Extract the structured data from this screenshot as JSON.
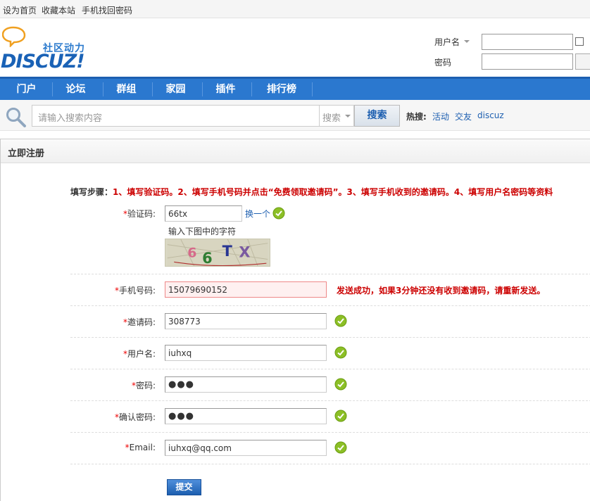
{
  "topbar": {
    "links": [
      "设为首页",
      "收藏本站",
      "手机找回密码"
    ]
  },
  "logo": {
    "slogan": "社区动力",
    "brand": "DISCUZ!"
  },
  "login": {
    "username_label": "用户名",
    "password_label": "密码"
  },
  "nav": {
    "items": [
      "门户",
      "论坛",
      "群组",
      "家园",
      "插件",
      "排行榜"
    ]
  },
  "search": {
    "placeholder": "请输入搜索内容",
    "type_label": "搜索",
    "button_label": "搜索",
    "hot_label": "热搜:",
    "hot_links": [
      "活动",
      "交友",
      "discuz"
    ]
  },
  "panel": {
    "title": "立即注册",
    "steps_label": "填写步骤：",
    "steps_text": "1、填写验证码。2、填写手机号码并点击“免费领取邀请码”。3、填写手机收到的邀请码。4、填写用户名密码等资料"
  },
  "form": {
    "captcha": {
      "label": "验证码:",
      "value": "66tx",
      "swap_label": "换一个",
      "hint": "输入下图中的字符",
      "image_text": "66TX"
    },
    "phone": {
      "label": "手机号码:",
      "value": "15079690152",
      "message": "发送成功，如果3分钟还没有收到邀请码，请重新发送。"
    },
    "invite": {
      "label": "邀请码:",
      "value": "308773"
    },
    "username": {
      "label": "用户名:",
      "value": "iuhxq"
    },
    "password": {
      "label": "密码:",
      "value": "●●●"
    },
    "confirm": {
      "label": "确认密码:",
      "value": "●●●"
    },
    "email": {
      "label": "Email:",
      "value": "iuhxq@qq.com"
    },
    "required_mark": "*",
    "submit_label": "提交"
  },
  "colors": {
    "nav_bg": "#2b78cf",
    "link": "#1d5fb0",
    "error": "#cc0000",
    "ok_icon": "#8cbf26"
  }
}
